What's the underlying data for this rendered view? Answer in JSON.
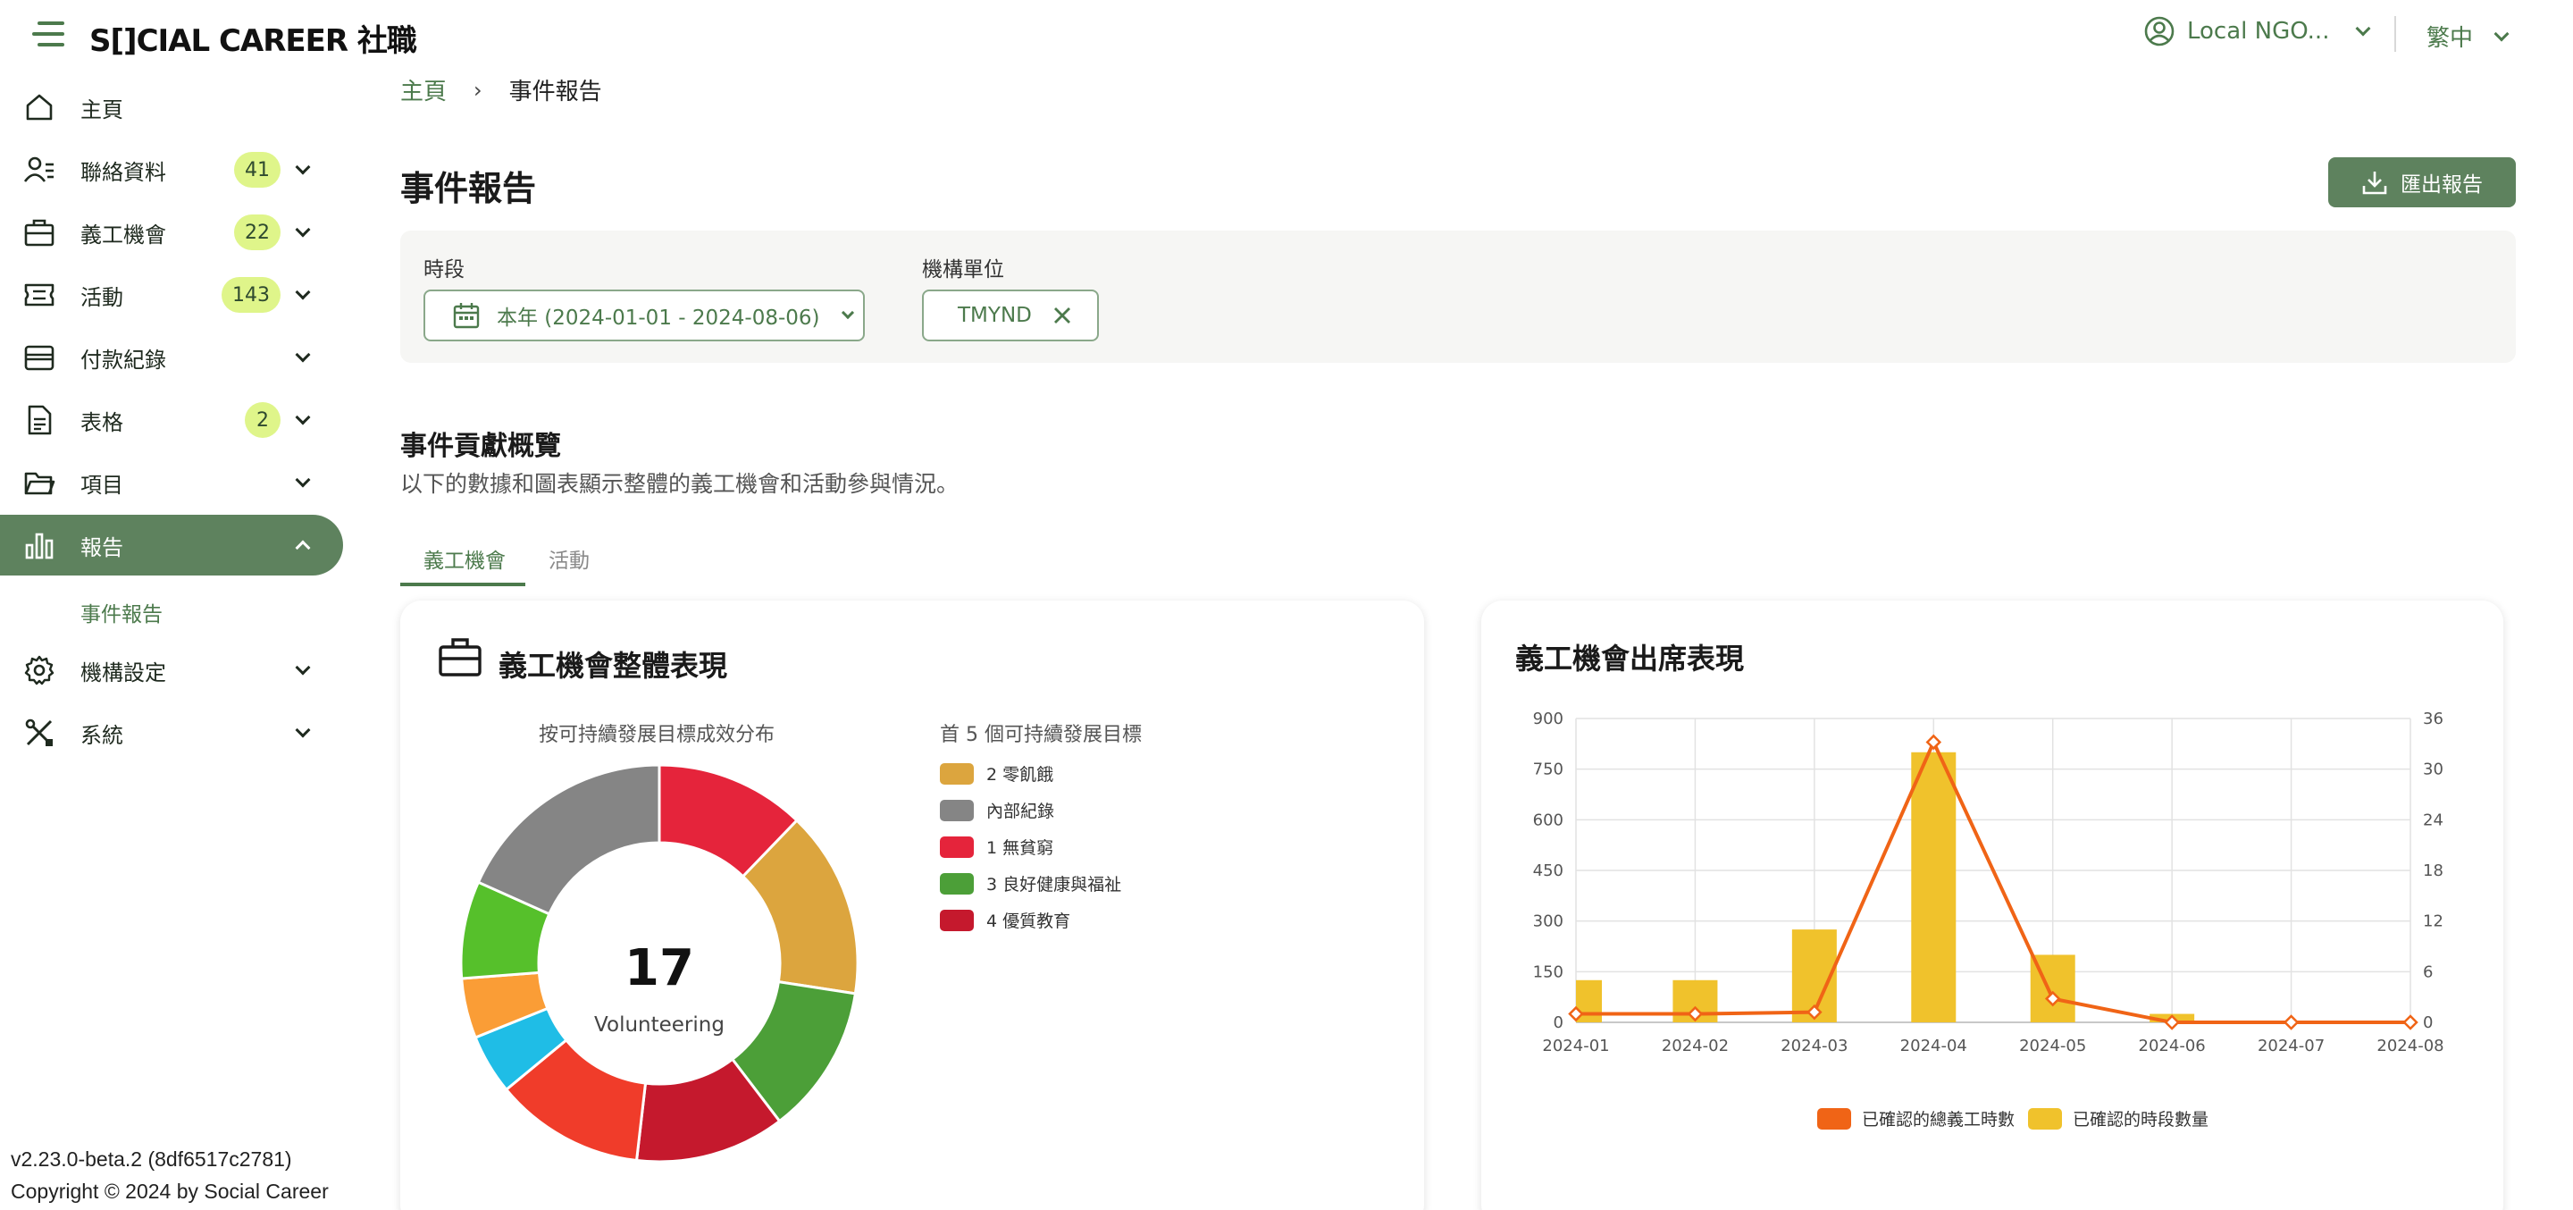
{
  "header": {
    "logo_text": "S[]CIAL CAREER 社職",
    "account_name": "Local NGO...",
    "language": "繁中"
  },
  "sidebar": {
    "items": [
      {
        "label": "主頁",
        "icon": "home-icon",
        "badge": null,
        "caret": false
      },
      {
        "label": "聯絡資料",
        "icon": "contacts-icon",
        "badge": "41",
        "caret": true
      },
      {
        "label": "義工機會",
        "icon": "briefcase-icon",
        "badge": "22",
        "caret": true
      },
      {
        "label": "活動",
        "icon": "ticket-icon",
        "badge": "143",
        "caret": true
      },
      {
        "label": "付款紀錄",
        "icon": "wallet-icon",
        "badge": null,
        "caret": true
      },
      {
        "label": "表格",
        "icon": "document-icon",
        "badge": "2",
        "caret": true
      },
      {
        "label": "項目",
        "icon": "folder-icon",
        "badge": null,
        "caret": true
      },
      {
        "label": "報告",
        "icon": "bar-chart-icon",
        "badge": null,
        "caret": true,
        "active": true
      },
      {
        "label": "機構設定",
        "icon": "gear-icon",
        "badge": null,
        "caret": true
      },
      {
        "label": "系統",
        "icon": "tools-icon",
        "badge": null,
        "caret": true
      }
    ],
    "sub_item": "事件報告",
    "version": "v2.23.0-beta.2 (8df6517c2781)",
    "copyright": "Copyright © 2024 by Social Career"
  },
  "breadcrumb": {
    "home": "主頁",
    "separator": "›",
    "current": "事件報告"
  },
  "page": {
    "title": "事件報告",
    "export_label": "匯出報告"
  },
  "filters": {
    "period_label": "時段",
    "period_value": "本年 (2024-01-01 - 2024-08-06)",
    "org_label": "機構單位",
    "org_value": "TMYND"
  },
  "overview": {
    "title": "事件貢獻概覽",
    "description": "以下的數據和圖表顯示整體的義工機會和活動參與情況。",
    "tabs": [
      "義工機會",
      "活動"
    ]
  },
  "colors": {
    "accent": "#5e825e",
    "badge": "#dff58a",
    "line": "#f06416",
    "bar": "#f0c22c"
  },
  "chart_data": [
    {
      "type": "pie",
      "title": "義工機會整體表現",
      "subtitle": "按可持續發展目標成效分布",
      "center_value": "17",
      "center_label": "Volunteering",
      "legend_title": "首 5 個可持續發展目標",
      "legend": [
        {
          "label": "2 零飢餓",
          "color": "#dca53e"
        },
        {
          "label": "內部紀錄",
          "color": "#858585"
        },
        {
          "label": "1 無貧窮",
          "color": "#e5243b"
        },
        {
          "label": "3 良好健康與福祉",
          "color": "#4c9f38"
        },
        {
          "label": "4 優質教育",
          "color": "#c5192d"
        }
      ],
      "slices": [
        {
          "value": 2,
          "color": "#e5243b"
        },
        {
          "value": 2.5,
          "color": "#dca53e"
        },
        {
          "value": 2,
          "color": "#4c9f38"
        },
        {
          "value": 2,
          "color": "#c5192d"
        },
        {
          "value": 2,
          "color": "#f03c2a"
        },
        {
          "value": 0.8,
          "color": "#1fbde6"
        },
        {
          "value": 0.8,
          "color": "#fa9d36"
        },
        {
          "value": 1.3,
          "color": "#56c02b"
        },
        {
          "value": 3,
          "color": "#858585"
        }
      ]
    },
    {
      "type": "bar",
      "title": "義工機會出席表現",
      "categories": [
        "2024-01",
        "2024-02",
        "2024-03",
        "2024-04",
        "2024-05",
        "2024-06",
        "2024-07",
        "2024-08"
      ],
      "y_left_ticks": [
        "0",
        "150",
        "300",
        "450",
        "600",
        "750",
        "900"
      ],
      "y_right_ticks": [
        "0",
        "6",
        "12",
        "18",
        "24",
        "30",
        "36"
      ],
      "ylim_left": [
        0,
        900
      ],
      "ylim_right": [
        0,
        36
      ],
      "series": [
        {
          "name": "已確認的總義工時數",
          "type": "line",
          "axis": "left",
          "color": "#f06416",
          "values": [
            25,
            25,
            30,
            830,
            70,
            0,
            0,
            0
          ]
        },
        {
          "name": "已確認的時段數量",
          "type": "bar",
          "axis": "right",
          "color": "#f0c22c",
          "values": [
            5,
            5,
            11,
            32,
            8,
            1,
            0,
            0
          ]
        }
      ]
    }
  ]
}
